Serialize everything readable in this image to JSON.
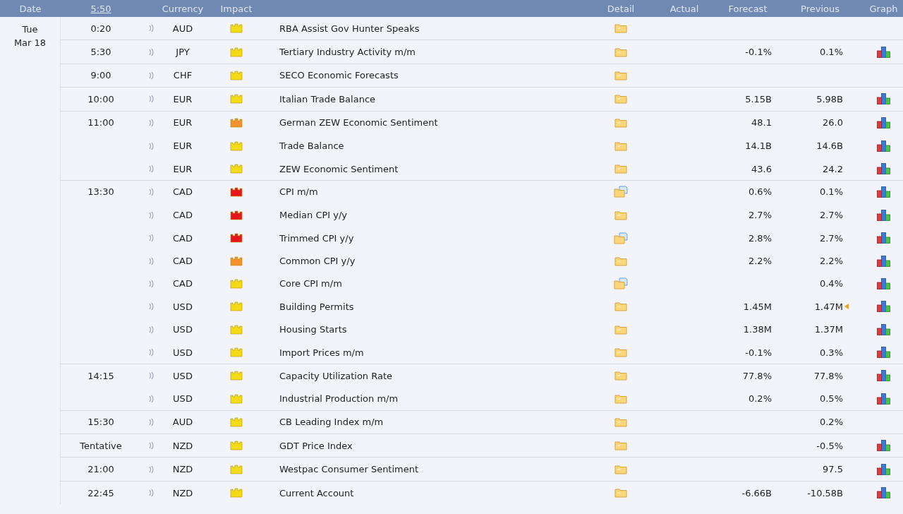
{
  "header": {
    "date": "Date",
    "clock": "5:50",
    "currency": "Currency",
    "impact": "Impact",
    "detail": "Detail",
    "actual": "Actual",
    "forecast": "Forecast",
    "previous": "Previous",
    "graph": "Graph"
  },
  "day": {
    "weekday": "Tue",
    "date": "Mar 18"
  },
  "groups": [
    {
      "time": "0:20",
      "rows": [
        {
          "currency": "AUD",
          "color": "#f4dc14",
          "event": "RBA Assist Gov Hunter Speaks",
          "document": false,
          "forecast": "",
          "previous": "",
          "revised": false,
          "graph": false
        }
      ]
    },
    {
      "time": "5:30",
      "rows": [
        {
          "currency": "JPY",
          "color": "#f4dc14",
          "event": "Tertiary Industry Activity m/m",
          "document": false,
          "forecast": "-0.1%",
          "previous": "0.1%",
          "revised": false,
          "graph": true
        }
      ]
    },
    {
      "time": "9:00",
      "rows": [
        {
          "currency": "CHF",
          "color": "#f4dc14",
          "event": "SECO Economic Forecasts",
          "document": false,
          "forecast": "",
          "previous": "",
          "revised": false,
          "graph": false
        }
      ]
    },
    {
      "time": "10:00",
      "rows": [
        {
          "currency": "EUR",
          "color": "#f4dc14",
          "event": "Italian Trade Balance",
          "document": false,
          "forecast": "5.15B",
          "previous": "5.98B",
          "revised": false,
          "graph": true
        }
      ]
    },
    {
      "time": "11:00",
      "rows": [
        {
          "currency": "EUR",
          "color": "#f2912e",
          "event": "German ZEW Economic Sentiment",
          "document": false,
          "forecast": "48.1",
          "previous": "26.0",
          "revised": false,
          "graph": true
        },
        {
          "currency": "EUR",
          "color": "#f4dc14",
          "event": "Trade Balance",
          "document": false,
          "forecast": "14.1B",
          "previous": "14.6B",
          "revised": false,
          "graph": true
        },
        {
          "currency": "EUR",
          "color": "#f4dc14",
          "event": "ZEW Economic Sentiment",
          "document": false,
          "forecast": "43.6",
          "previous": "24.2",
          "revised": false,
          "graph": true
        }
      ]
    },
    {
      "time": "13:30",
      "rows": [
        {
          "currency": "CAD",
          "color": "#e8161b",
          "event": "CPI m/m",
          "document": true,
          "forecast": "0.6%",
          "previous": "0.1%",
          "revised": false,
          "graph": true
        },
        {
          "currency": "CAD",
          "color": "#e8161b",
          "event": "Median CPI y/y",
          "document": false,
          "forecast": "2.7%",
          "previous": "2.7%",
          "revised": false,
          "graph": true
        },
        {
          "currency": "CAD",
          "color": "#e8161b",
          "event": "Trimmed CPI y/y",
          "document": true,
          "forecast": "2.8%",
          "previous": "2.7%",
          "revised": false,
          "graph": true
        },
        {
          "currency": "CAD",
          "color": "#f2912e",
          "event": "Common CPI y/y",
          "document": false,
          "forecast": "2.2%",
          "previous": "2.2%",
          "revised": false,
          "graph": true
        },
        {
          "currency": "CAD",
          "color": "#f4dc14",
          "event": "Core CPI m/m",
          "document": true,
          "forecast": "",
          "previous": "0.4%",
          "revised": false,
          "graph": true
        },
        {
          "currency": "USD",
          "color": "#f4dc14",
          "event": "Building Permits",
          "document": false,
          "forecast": "1.45M",
          "previous": "1.47M",
          "revised": true,
          "graph": true
        },
        {
          "currency": "USD",
          "color": "#f4dc14",
          "event": "Housing Starts",
          "document": false,
          "forecast": "1.38M",
          "previous": "1.37M",
          "revised": false,
          "graph": true
        },
        {
          "currency": "USD",
          "color": "#f4dc14",
          "event": "Import Prices m/m",
          "document": false,
          "forecast": "-0.1%",
          "previous": "0.3%",
          "revised": false,
          "graph": true
        }
      ]
    },
    {
      "time": "14:15",
      "rows": [
        {
          "currency": "USD",
          "color": "#f4dc14",
          "event": "Capacity Utilization Rate",
          "document": false,
          "forecast": "77.8%",
          "previous": "77.8%",
          "revised": false,
          "graph": true
        },
        {
          "currency": "USD",
          "color": "#f4dc14",
          "event": "Industrial Production m/m",
          "document": false,
          "forecast": "0.2%",
          "previous": "0.5%",
          "revised": false,
          "graph": true
        }
      ]
    },
    {
      "time": "15:30",
      "rows": [
        {
          "currency": "AUD",
          "color": "#f4dc14",
          "event": "CB Leading Index m/m",
          "document": false,
          "forecast": "",
          "previous": "0.2%",
          "revised": false,
          "graph": false
        }
      ]
    },
    {
      "time": "Tentative",
      "rows": [
        {
          "currency": "NZD",
          "color": "#f4dc14",
          "event": "GDT Price Index",
          "document": false,
          "forecast": "",
          "previous": "-0.5%",
          "revised": false,
          "graph": true
        }
      ]
    },
    {
      "time": "21:00",
      "rows": [
        {
          "currency": "NZD",
          "color": "#f4dc14",
          "event": "Westpac Consumer Sentiment",
          "document": false,
          "forecast": "",
          "previous": "97.5",
          "revised": false,
          "graph": true
        }
      ]
    },
    {
      "time": "22:45",
      "rows": [
        {
          "currency": "NZD",
          "color": "#f4dc14",
          "event": "Current Account",
          "document": false,
          "forecast": "-6.66B",
          "previous": "-10.58B",
          "revised": false,
          "graph": true
        }
      ]
    }
  ]
}
